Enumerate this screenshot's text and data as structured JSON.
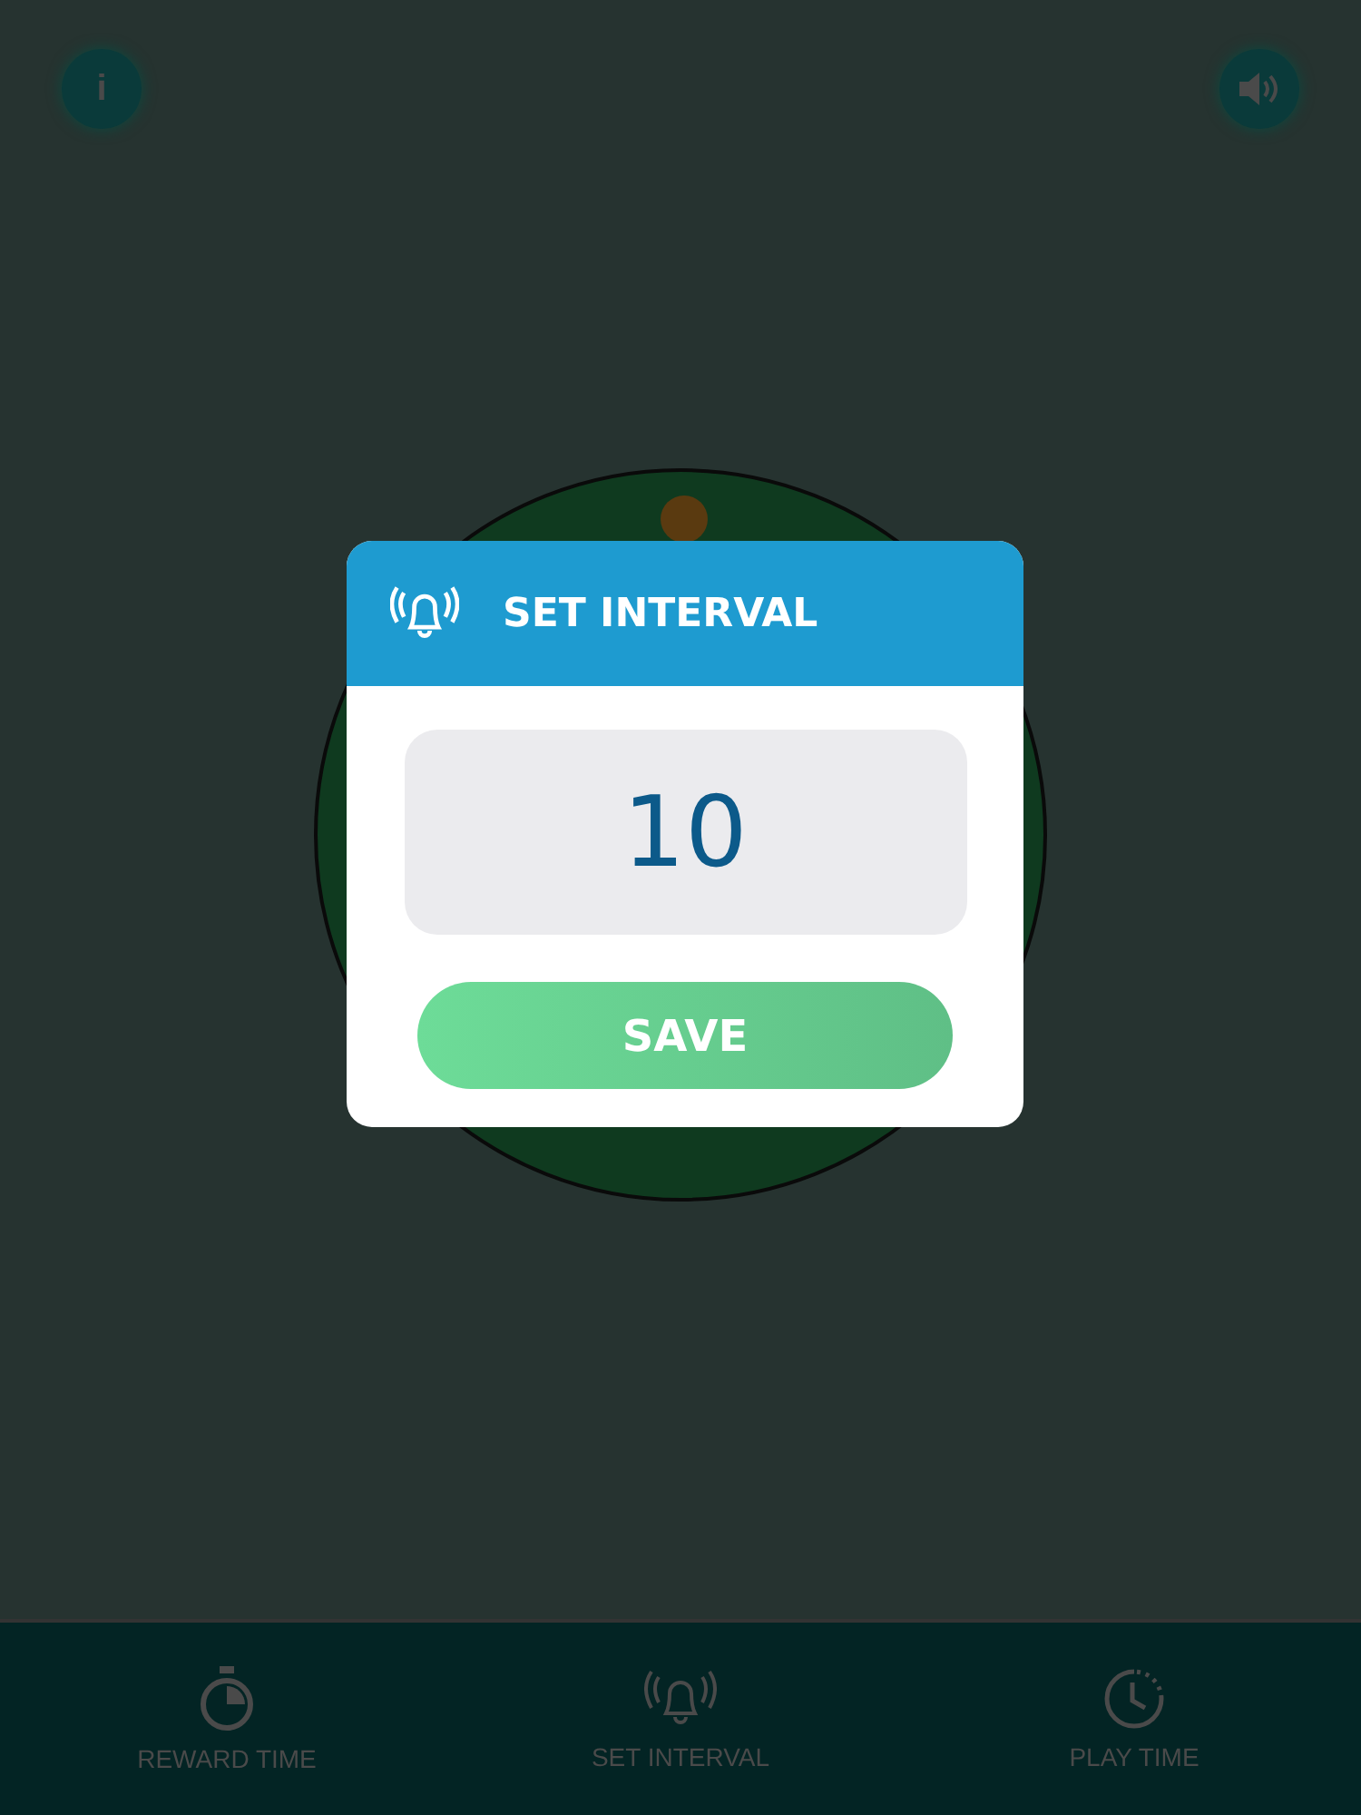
{
  "top_bar": {
    "info_button": {
      "label": "i"
    }
  },
  "dialog": {
    "title": "SET INTERVAL",
    "value": "10",
    "button": "SAVE"
  },
  "bottom_nav": [
    {
      "kind": "stopwatch",
      "label": "REWARD TIME"
    },
    {
      "kind": "bell",
      "label": "SET INTERVAL"
    },
    {
      "kind": "clock",
      "label": "PLAY TIME"
    }
  ]
}
